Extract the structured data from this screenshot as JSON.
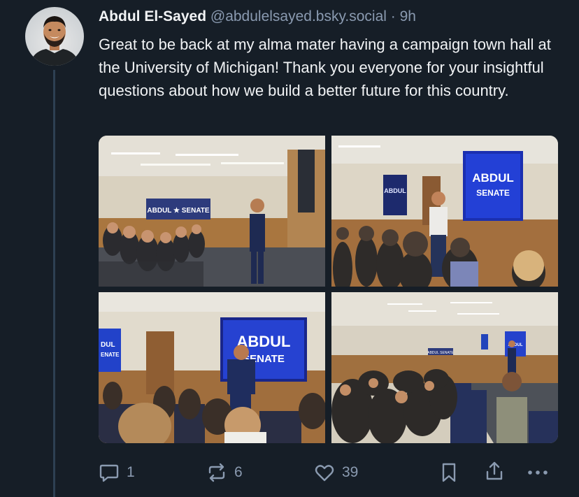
{
  "post": {
    "author_name": "Abdul El-Sayed",
    "handle": "@abdulelsayed.bsky.social",
    "separator": "·",
    "time": "9h",
    "text": "Great to be back at my alma mater having a campaign town hall at the University of Michigan! Thank you everyone for your insightful questions about how we build a better future for this country."
  },
  "images": [
    {
      "banner": "ABDUL ★ SENATE"
    },
    {
      "screen_line1": "ABDUL",
      "screen_line2": "SENATE"
    },
    {
      "screen_line1": "ABDUL",
      "screen_line2": "SENATE",
      "edge_line1": "DUL",
      "edge_line2": "ENATE"
    },
    {
      "screen_line1": "ABDUL",
      "banner": "ABDUL SENATE"
    }
  ],
  "actions": {
    "replies": "1",
    "reposts": "6",
    "likes": "39"
  },
  "icons": [
    "reply-icon",
    "repost-icon",
    "like-icon",
    "bookmark-icon",
    "share-icon",
    "more-icon"
  ],
  "colors": {
    "background": "#161e27",
    "text": "#f1f3f5",
    "muted": "#8a9ab0",
    "thread_line": "#2e4052"
  }
}
